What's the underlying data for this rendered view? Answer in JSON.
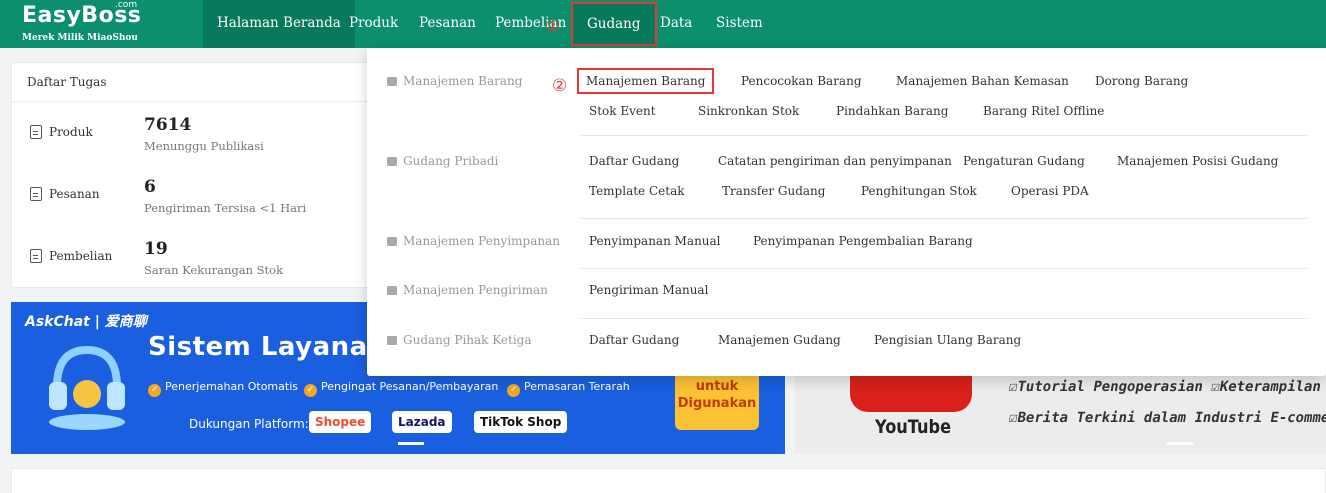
{
  "app": {
    "logo": "EasyBoss",
    "logo_com": ".com",
    "logo_sub": "Merek Milik MiaoShou"
  },
  "nav": {
    "items": [
      "Halaman Beranda",
      "Produk",
      "Pesanan",
      "Pembelian",
      "Gudang",
      "Data",
      "Sistem"
    ],
    "annotation_1": "①",
    "annotation_2": "②"
  },
  "tasks": {
    "title": "Daftar Tugas",
    "rows": [
      {
        "label": "Produk",
        "count": "7614",
        "desc": "Menunggu Publikasi"
      },
      {
        "label": "Pesanan",
        "count": "6",
        "desc": "Pengiriman Tersisa <1 Hari"
      },
      {
        "label": "Pembelian",
        "count": "19",
        "desc": "Saran Kekurangan Stok"
      }
    ]
  },
  "dropdown": {
    "groups": [
      {
        "label": "Manajemen Barang",
        "links": [
          "Manajemen Barang",
          "Pencocokan Barang",
          "Manajemen Bahan Kemasan",
          "Dorong Barang",
          "Stok Event",
          "Sinkronkan Stok",
          "Pindahkan Barang",
          "Barang Ritel Offline"
        ]
      },
      {
        "label": "Gudang Pribadi",
        "links": [
          "Daftar Gudang",
          "Catatan pengiriman dan penyimpanan",
          "Pengaturan Gudang",
          "Manajemen Posisi Gudang",
          "Template Cetak",
          "Transfer Gudang",
          "Penghitungan Stok",
          "Operasi PDA"
        ]
      },
      {
        "label": "Manajemen Penyimpanan",
        "links": [
          "Penyimpanan Manual",
          "Penyimpanan Pengembalian Barang"
        ]
      },
      {
        "label": "Manajemen Pengiriman",
        "links": [
          "Pengiriman Manual"
        ]
      },
      {
        "label": "Gudang Pihak Ketiga",
        "links": [
          "Daftar Gudang",
          "Manajemen Gudang",
          "Pengisian Ulang Barang"
        ]
      }
    ]
  },
  "banner": {
    "brand": "AskChat | 爱商聊",
    "headline": "Sistem Layanan",
    "features": [
      "Penerjemahan Otomatis",
      "Pengingat Pesanan/Pembayaran",
      "Pemasaran Terarah"
    ],
    "platform_label": "Dukungan Platform:",
    "platforms": [
      "Shopee",
      "Lazada",
      "TikTok Shop"
    ],
    "cta": [
      "untuk",
      "Digunakan"
    ],
    "accent": "#1a5fe0",
    "cta_color": "#fbc234"
  },
  "banner2": {
    "logo_text": "YouTube",
    "line1": "☑Tutorial Pengoperasian ☑Keterampilan",
    "line2": "☑Berita Terkini dalam Industri E-commerce",
    "logo_color": "#d9201c"
  },
  "colors": {
    "topbar": "#0b8f6c",
    "topbar_active": "#087a5c",
    "highlight": "#e53935"
  }
}
